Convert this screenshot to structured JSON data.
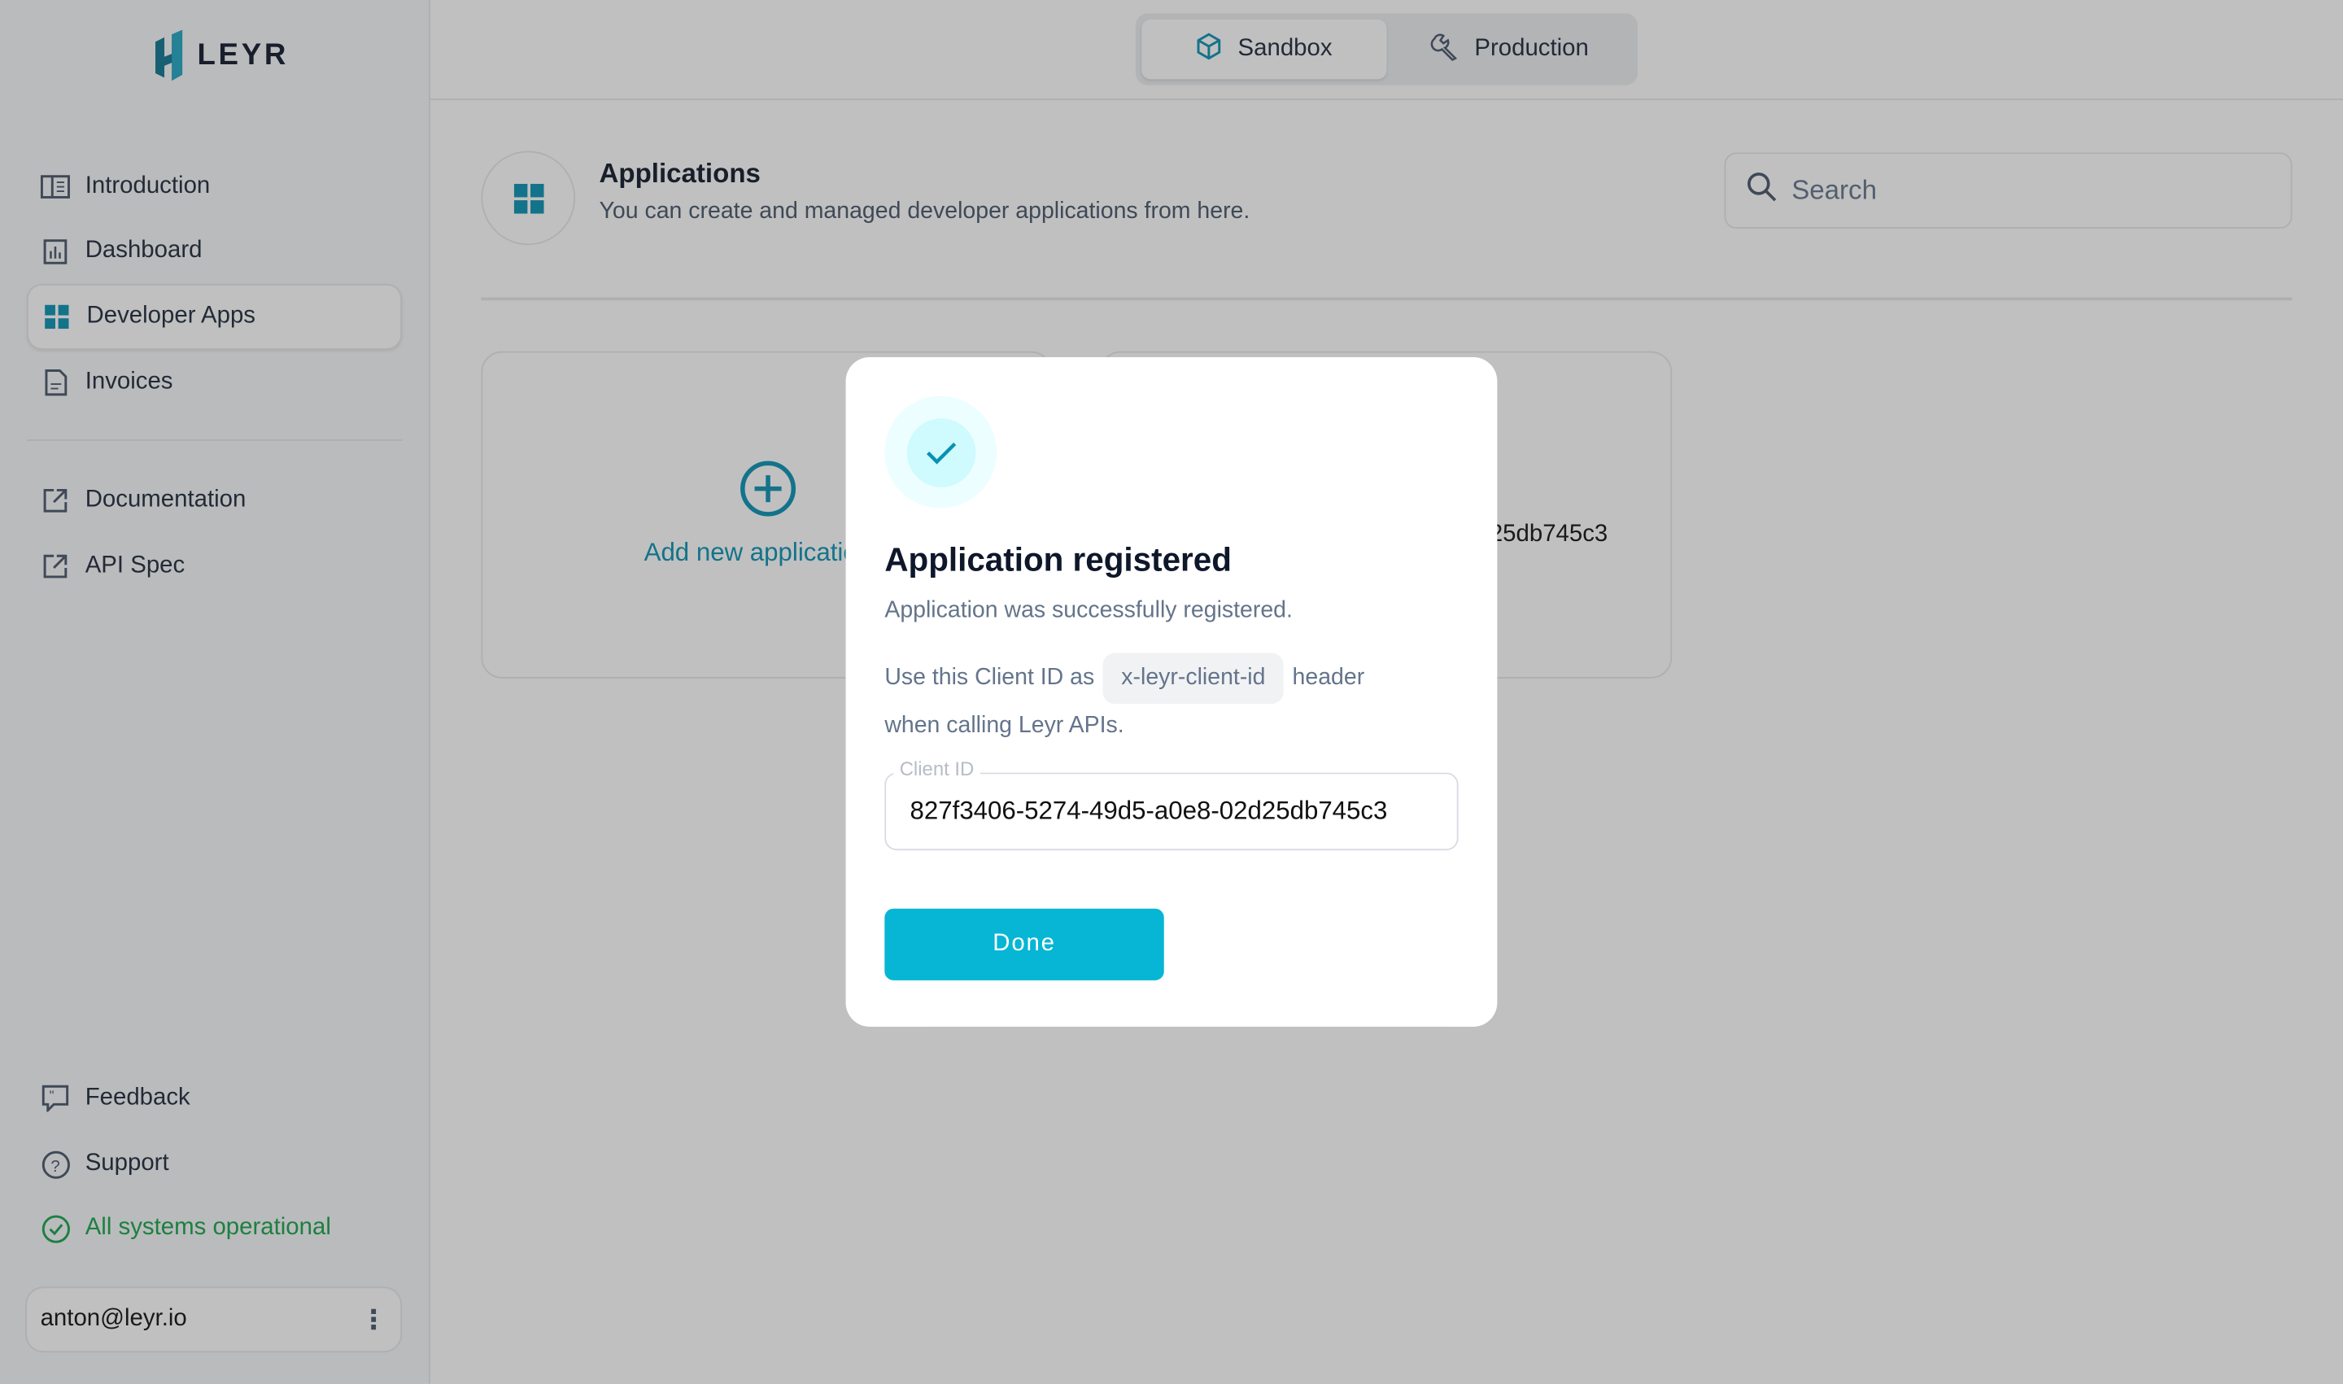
{
  "brand": {
    "name": "LEYR",
    "accent": "#0891b2"
  },
  "env_switch": {
    "items": [
      {
        "label": "Sandbox",
        "icon": "cube-icon",
        "active": true
      },
      {
        "label": "Production",
        "icon": "wrench-icon",
        "active": false
      }
    ]
  },
  "sidebar": {
    "items": [
      {
        "label": "Introduction",
        "icon": "book-icon"
      },
      {
        "label": "Dashboard",
        "icon": "chart-icon"
      },
      {
        "label": "Developer Apps",
        "icon": "grid-icon",
        "active": true
      },
      {
        "label": "Invoices",
        "icon": "document-icon"
      }
    ],
    "links": [
      {
        "label": "Documentation",
        "icon": "external-link-icon"
      },
      {
        "label": "API Spec",
        "icon": "external-link-icon"
      }
    ],
    "bottom": [
      {
        "label": "Feedback",
        "icon": "feedback-icon"
      },
      {
        "label": "Support",
        "icon": "help-icon"
      }
    ],
    "status": "All systems operational",
    "user": "anton@leyr.io"
  },
  "header": {
    "title": "Applications",
    "subtitle": "You can create and managed developer applications from here.",
    "search_placeholder": "Search"
  },
  "cards": {
    "add_label": "Add new application",
    "app_id_fragment": "...25db745c3"
  },
  "modal": {
    "title": "Application registered",
    "subtitle": "Application was successfully registered.",
    "use_prefix": "Use this Client ID as",
    "header_name": "x-leyr-client-id",
    "use_suffix": "header",
    "use_tail": "when calling Leyr APIs.",
    "field_label": "Client ID",
    "client_id": "827f3406-5274-49d5-a0e8-02d25db745c3",
    "done_label": "Done"
  }
}
